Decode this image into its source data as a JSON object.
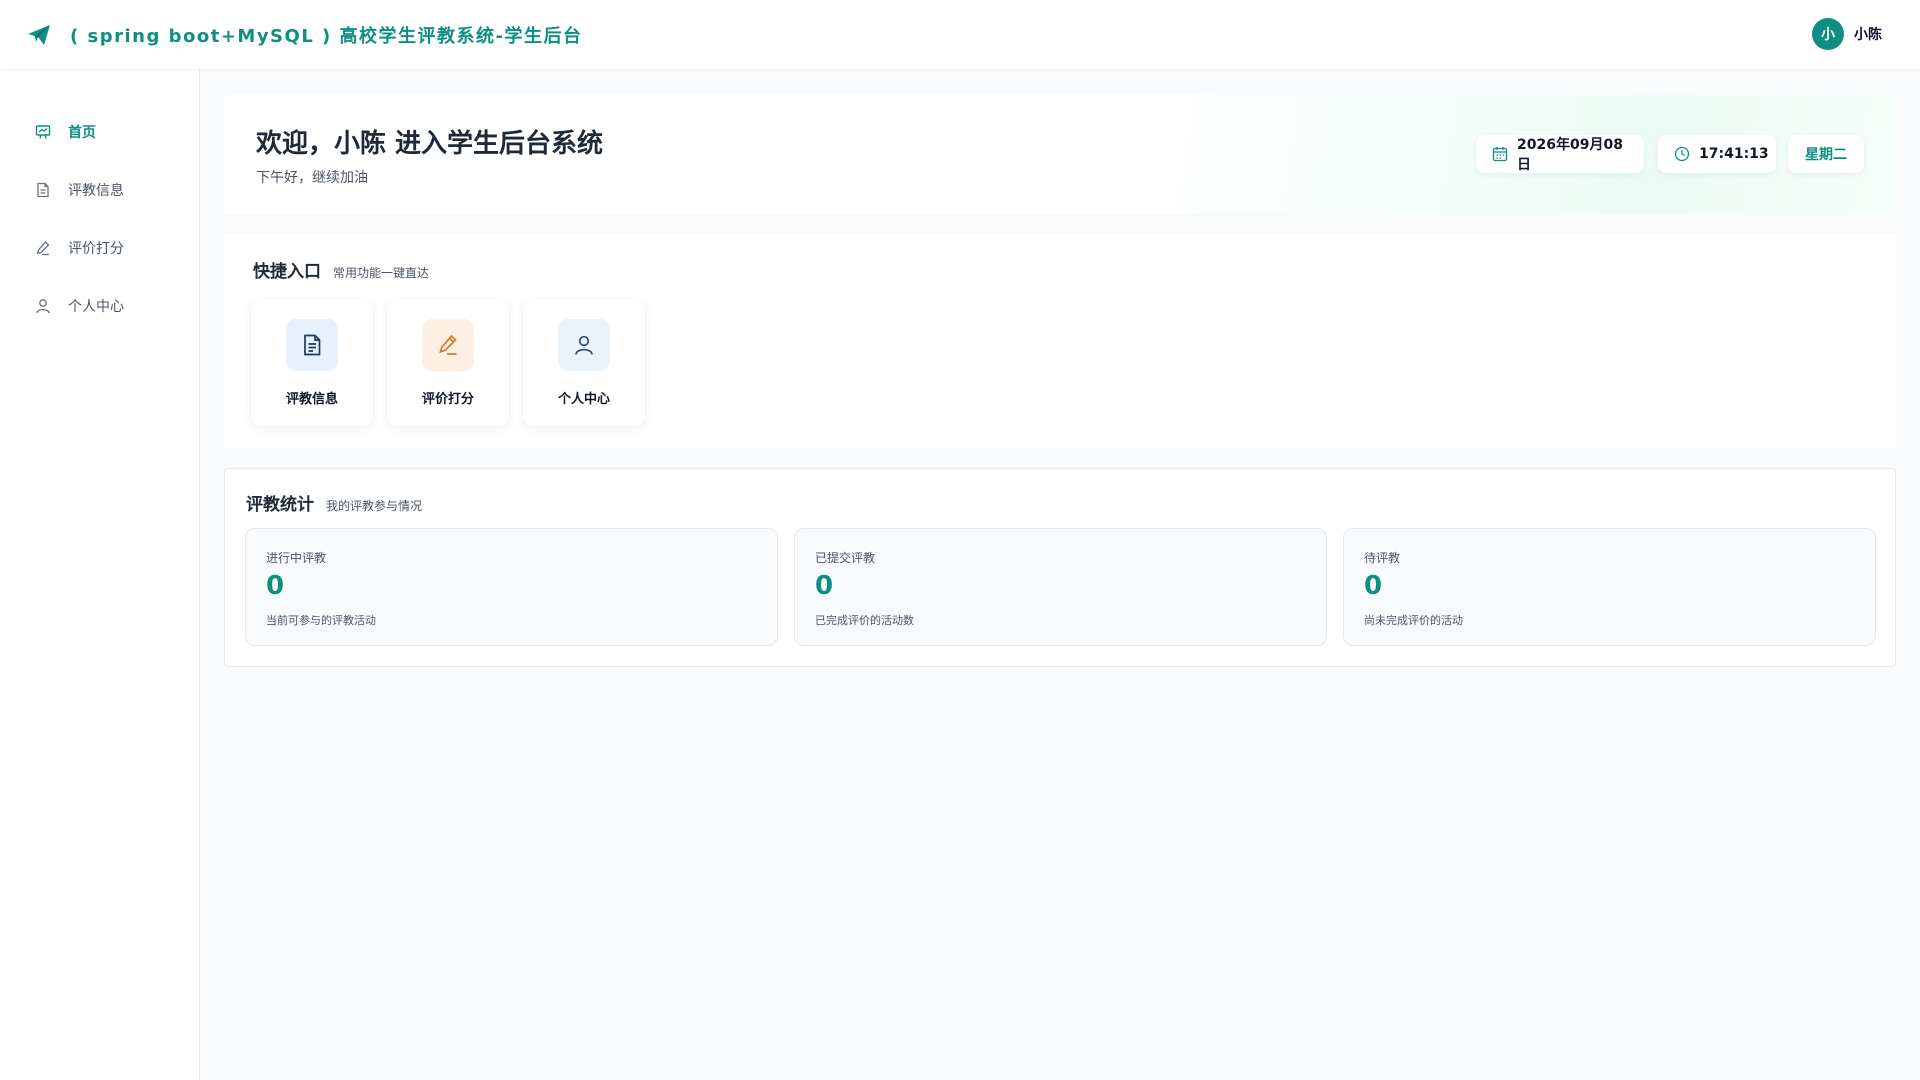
{
  "header": {
    "title": "( spring boot+MySQL ) 高校学生评教系统-学生后台",
    "brand_icon": "paper-plane-icon",
    "user_initial": "小",
    "user_name": "小陈"
  },
  "sidebar": {
    "items": [
      {
        "label": "首页",
        "icon": "presentation-board-icon",
        "active": true
      },
      {
        "label": "评教信息",
        "icon": "document-icon",
        "active": false
      },
      {
        "label": "评价打分",
        "icon": "pen-icon",
        "active": false
      },
      {
        "label": "个人中心",
        "icon": "user-icon",
        "active": false
      }
    ]
  },
  "welcome": {
    "title": "欢迎，小陈 进入学生后台系统",
    "subtitle": "下午好，继续加油",
    "date": "2026年09月08日",
    "time": "17:41:13",
    "weekday": "星期二"
  },
  "quick": {
    "title": "快捷入口",
    "subtitle": "常用功能一键直达",
    "items": [
      {
        "label": "评教信息",
        "icon": "document-icon"
      },
      {
        "label": "评价打分",
        "icon": "pen-icon"
      },
      {
        "label": "个人中心",
        "icon": "user-icon"
      }
    ]
  },
  "stats": {
    "title": "评教统计",
    "subtitle": "我的评教参与情况",
    "cards": [
      {
        "title": "进行中评教",
        "value": "0",
        "desc": "当前可参与的评教活动"
      },
      {
        "title": "已提交评教",
        "value": "0",
        "desc": "已完成评价的活动数"
      },
      {
        "title": "待评教",
        "value": "0",
        "desc": "尚未完成评价的活动"
      }
    ]
  },
  "colors": {
    "accent": "#0f8f82",
    "quick_doc_bg": "#e6f1fb",
    "quick_pen_bg": "#fdefe1",
    "quick_user_bg": "#e8f3fb"
  }
}
